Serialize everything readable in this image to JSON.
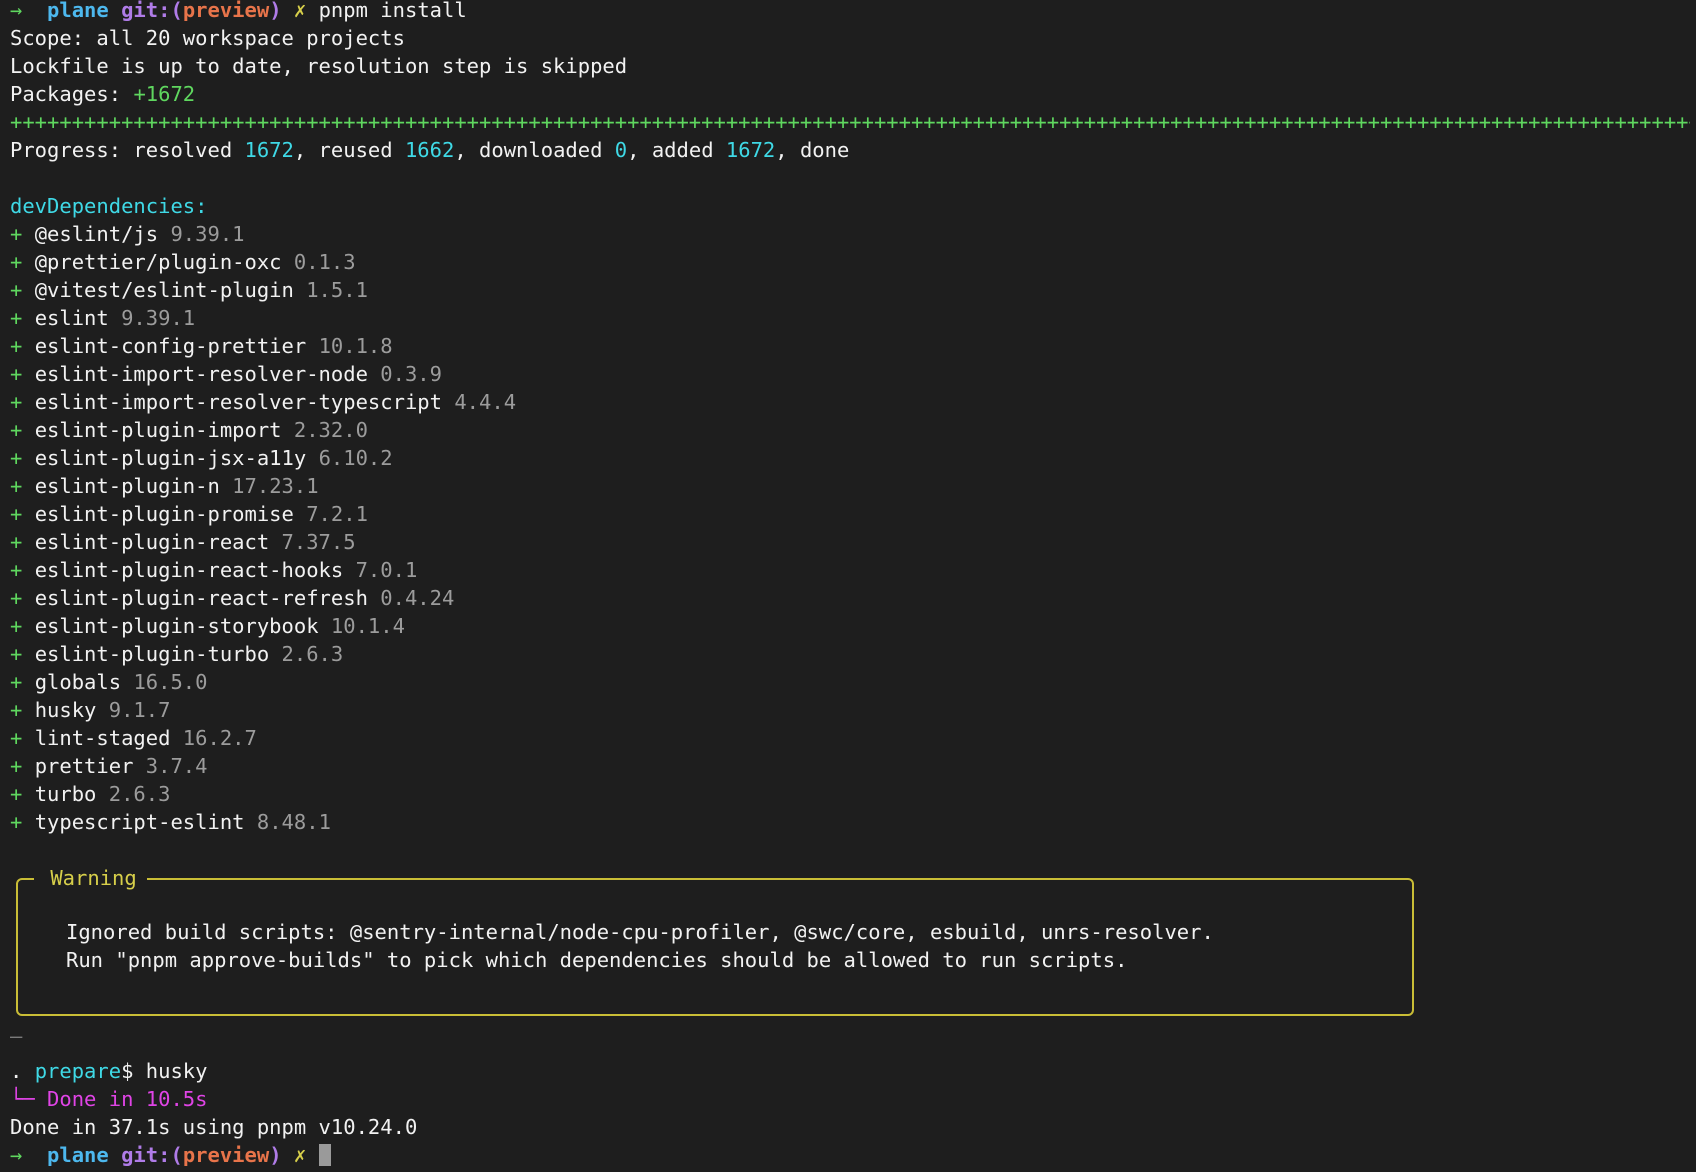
{
  "prompt": {
    "arrow": "→",
    "dir": "plane",
    "git_prefix": "git:(",
    "branch": "preview",
    "git_suffix": ")",
    "dirty_mark": "✗",
    "command": "pnpm install"
  },
  "scope_line": "Scope: all 20 workspace projects",
  "lockfile_line": "Lockfile is up to date, resolution step is skipped",
  "packages": {
    "label": "Packages:",
    "value": "+1672"
  },
  "progress_bar": "++++++++++++++++++++++++++++++++++++++++++++++++++++++++++++++++++++++++++++++++++++++++++++++++++++++++++++++++++++++++++++++++++++++++++++++++++++++++++++++++++++++++++++++++++++++++++++++++++++",
  "progress": {
    "label": "Progress: resolved ",
    "resolved": "1672",
    "reused_label": ", reused ",
    "reused": "1662",
    "downloaded_label": ", downloaded ",
    "downloaded": "0",
    "added_label": ", added ",
    "added": "1672",
    "done_label": ", done"
  },
  "dev_header": "devDependencies:",
  "plus": "+",
  "deps": [
    {
      "name": "@eslint/js",
      "version": "9.39.1"
    },
    {
      "name": "@prettier/plugin-oxc",
      "version": "0.1.3"
    },
    {
      "name": "@vitest/eslint-plugin",
      "version": "1.5.1"
    },
    {
      "name": "eslint",
      "version": "9.39.1"
    },
    {
      "name": "eslint-config-prettier",
      "version": "10.1.8"
    },
    {
      "name": "eslint-import-resolver-node",
      "version": "0.3.9"
    },
    {
      "name": "eslint-import-resolver-typescript",
      "version": "4.4.4"
    },
    {
      "name": "eslint-plugin-import",
      "version": "2.32.0"
    },
    {
      "name": "eslint-plugin-jsx-a11y",
      "version": "6.10.2"
    },
    {
      "name": "eslint-plugin-n",
      "version": "17.23.1"
    },
    {
      "name": "eslint-plugin-promise",
      "version": "7.2.1"
    },
    {
      "name": "eslint-plugin-react",
      "version": "7.37.5"
    },
    {
      "name": "eslint-plugin-react-hooks",
      "version": "7.0.1"
    },
    {
      "name": "eslint-plugin-react-refresh",
      "version": "0.4.24"
    },
    {
      "name": "eslint-plugin-storybook",
      "version": "10.1.4"
    },
    {
      "name": "eslint-plugin-turbo",
      "version": "2.6.3"
    },
    {
      "name": "globals",
      "version": "16.5.0"
    },
    {
      "name": "husky",
      "version": "9.1.7"
    },
    {
      "name": "lint-staged",
      "version": "16.2.7"
    },
    {
      "name": "prettier",
      "version": "3.7.4"
    },
    {
      "name": "turbo",
      "version": "2.6.3"
    },
    {
      "name": "typescript-eslint",
      "version": "8.48.1"
    }
  ],
  "warning": {
    "title": "Warning",
    "line1": "Ignored build scripts: @sentry-internal/node-cpu-profiler, @swc/core, esbuild, unrs-resolver.",
    "line2": "Run \"pnpm approve-builds\" to pick which dependencies should be allowed to run scripts."
  },
  "separator": "—",
  "prepare": {
    "dot": ".",
    "script": "prepare",
    "dollar": "$",
    "command": "husky",
    "tree": "└─",
    "done": "Done in 10.5s"
  },
  "final_line": "Done in 37.1s using pnpm v10.24.0",
  "colors": {
    "background": "#1e1e1e",
    "green": "#5fd75f",
    "cyan": "#3fd9e6",
    "blue": "#4db8ee",
    "purple": "#b07ce8",
    "orange": "#e8744a",
    "yellow": "#d7cf4a",
    "gray": "#9c9c9c",
    "magenta": "#e044e6"
  }
}
